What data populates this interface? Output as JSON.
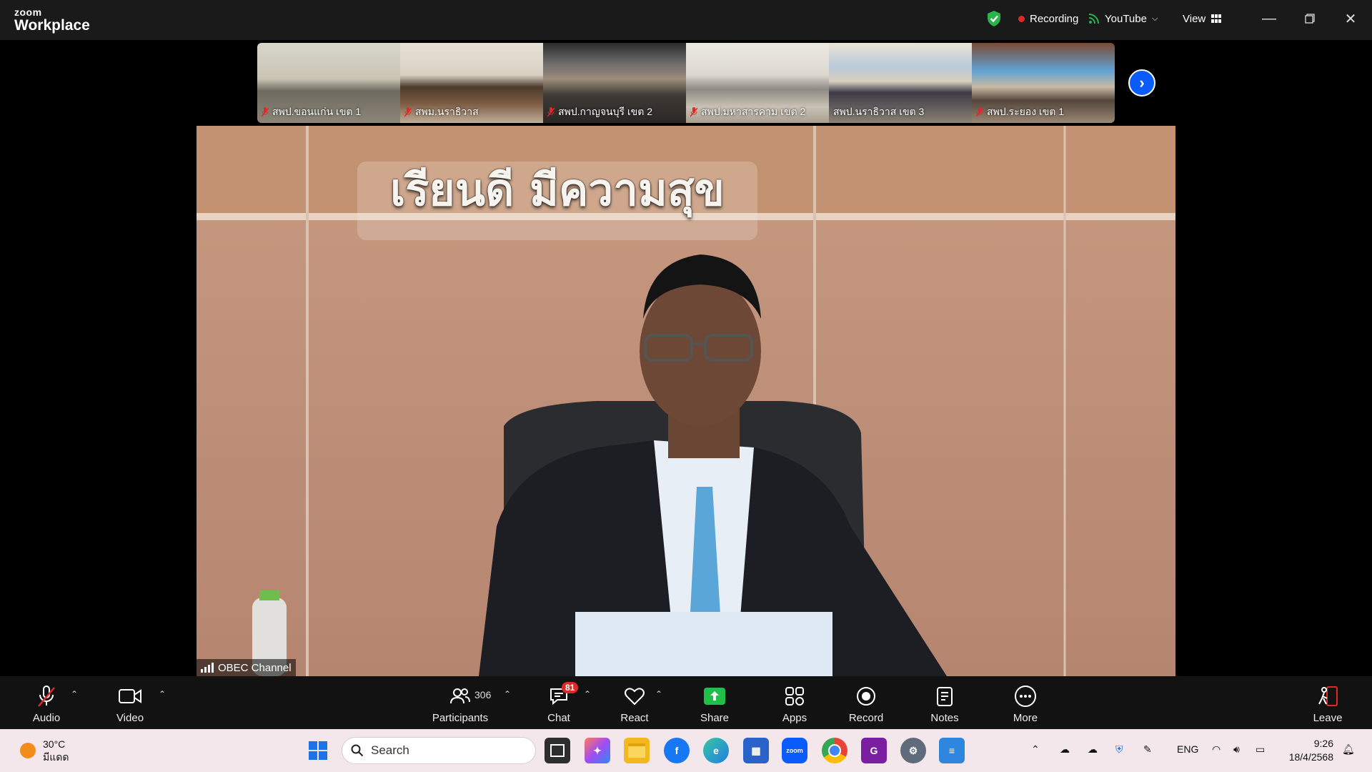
{
  "titlebar": {
    "logo_top": "zoom",
    "logo_bottom": "Workplace",
    "recording": "Recording",
    "stream": "YouTube",
    "view": "View"
  },
  "thumbnails": [
    {
      "name": "สพป.ขอนแก่น เขต 1"
    },
    {
      "name": "สพม.นราธิวาส"
    },
    {
      "name": "สพป.กาญจนบุรี เขต 2"
    },
    {
      "name": "สพป.มหาสารคาม เขต 2"
    },
    {
      "name": "สพป.นราธิวาส เขต 3"
    },
    {
      "name": "สพป.ระยอง เขต 1"
    }
  ],
  "main_video": {
    "banner": "เรียนดี มีความสุข",
    "participant_name": "OBEC Channel"
  },
  "toolbar": {
    "audio": "Audio",
    "video": "Video",
    "participants": "Participants",
    "participants_count": "306",
    "chat": "Chat",
    "chat_badge": "81",
    "react": "React",
    "share": "Share",
    "apps": "Apps",
    "record": "Record",
    "notes": "Notes",
    "more": "More",
    "leave": "Leave"
  },
  "taskbar": {
    "temperature": "30°C",
    "weather": "มีแดด",
    "search_placeholder": "Search",
    "language": "ENG",
    "time": "9:26",
    "date": "18/4/2568"
  }
}
